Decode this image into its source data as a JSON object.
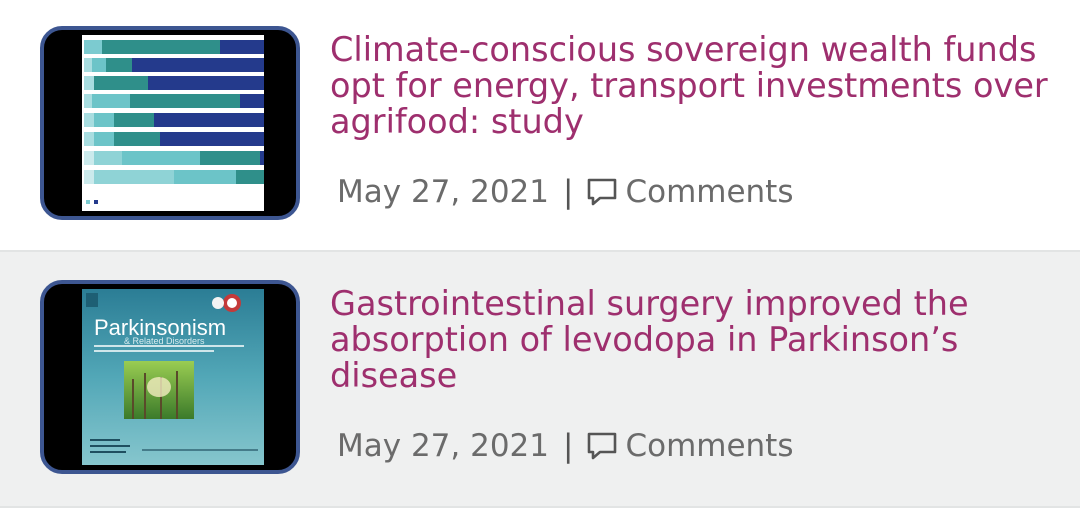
{
  "articles": [
    {
      "title": "Climate-conscious sovereign wealth funds opt for energy, transport investments over agrifood: study",
      "date": "May 27, 2021",
      "separator": "|",
      "comments_label": "Comments",
      "thumbnail": "stacked-bar-chart-image"
    },
    {
      "title": "Gastrointestinal surgery improved the absorption of levodopa in Parkinson’s disease",
      "date": "May 27, 2021",
      "separator": "|",
      "comments_label": "Comments",
      "thumbnail": "journal-cover-image",
      "cover": {
        "journal_name": "Parkinsonism",
        "journal_subtitle": "& Related Disorders"
      }
    }
  ],
  "colors": {
    "title": "#9e2f6e",
    "meta": "#6b6b6b",
    "thumb_border": "#3d5691",
    "row_alt_bg": "#eff0f0"
  }
}
